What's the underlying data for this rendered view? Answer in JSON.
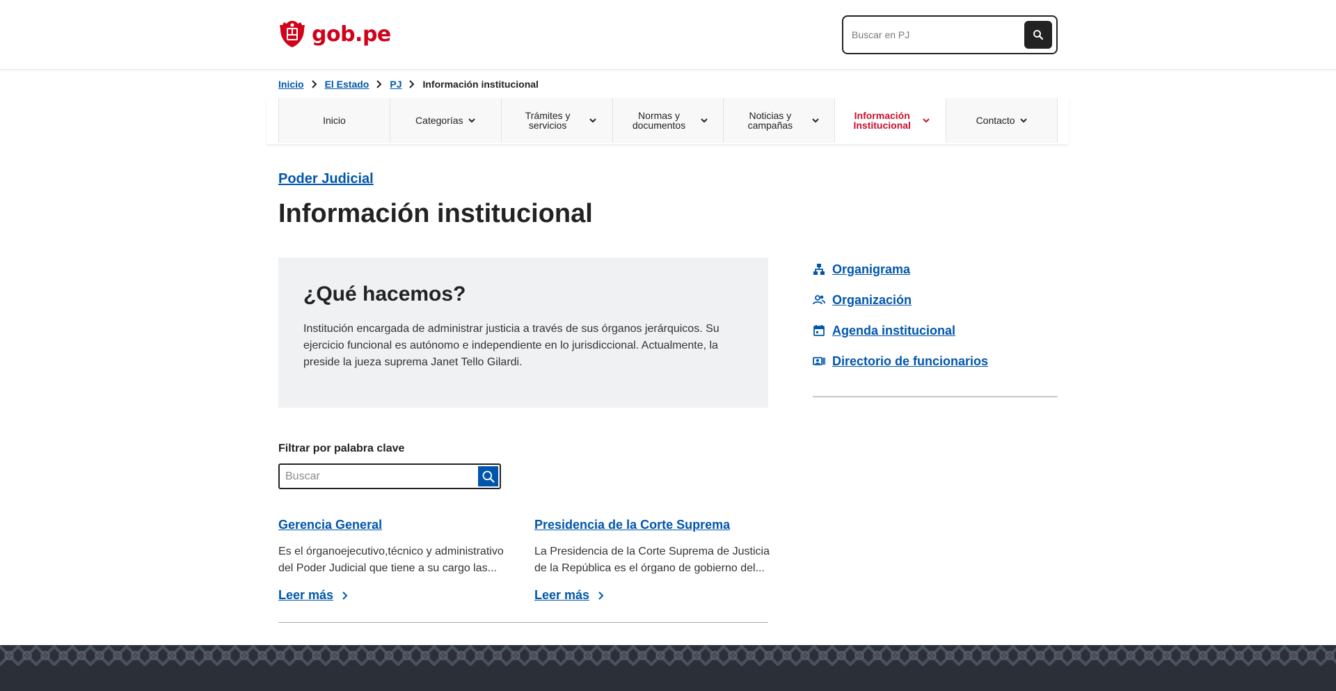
{
  "header": {
    "logo_text": "gob.pe",
    "search_placeholder": "Buscar en PJ"
  },
  "breadcrumb": [
    {
      "label": "Inicio"
    },
    {
      "label": "El Estado"
    },
    {
      "label": "PJ"
    },
    {
      "label": "Información institucional"
    }
  ],
  "nav": [
    {
      "label": "Inicio",
      "dropdown": false,
      "active": false
    },
    {
      "label": "Categorías",
      "dropdown": true,
      "active": false
    },
    {
      "label": "Trámites y servicios",
      "dropdown": true,
      "active": false
    },
    {
      "label": "Normas y documentos",
      "dropdown": true,
      "active": false
    },
    {
      "label": "Noticias y campañas",
      "dropdown": true,
      "active": false
    },
    {
      "label": "Información Institucional",
      "dropdown": true,
      "active": true
    },
    {
      "label": "Contacto",
      "dropdown": true,
      "active": false
    }
  ],
  "page": {
    "parent_link": "Poder Judicial",
    "title": "Información institucional"
  },
  "card": {
    "title": "¿Qué hacemos?",
    "text": "Institución encargada de administrar justicia a través de sus órganos jerárquicos. Su ejercicio funcional es autónomo e independiente en lo jurisdiccional. Actualmente, la preside la jueza suprema Janet Tello Gilardi."
  },
  "side_links": [
    {
      "label": "Organigrama",
      "icon": "org-chart-icon"
    },
    {
      "label": "Organización",
      "icon": "people-icon"
    },
    {
      "label": "Agenda institucional",
      "icon": "calendar-icon"
    },
    {
      "label": "Directorio de funcionarios",
      "icon": "contact-card-icon"
    }
  ],
  "filter": {
    "label": "Filtrar por palabra clave",
    "placeholder": "Buscar"
  },
  "results": [
    {
      "title": "Gerencia General",
      "description": "Es el órganoejecutivo,técnico y administrativo del Poder Judicial que tiene a su cargo las...",
      "read_more": "Leer más"
    },
    {
      "title": "Presidencia de la Corte Suprema",
      "description": "La Presidencia de la Corte Suprema de Justicia de la República es el órgano de gobierno del...",
      "read_more": "Leer más"
    }
  ],
  "colors": {
    "link": "#0056ac",
    "brand_red": "#d0021b",
    "active_nav": "#c8102e",
    "footer": "#2b3038"
  }
}
